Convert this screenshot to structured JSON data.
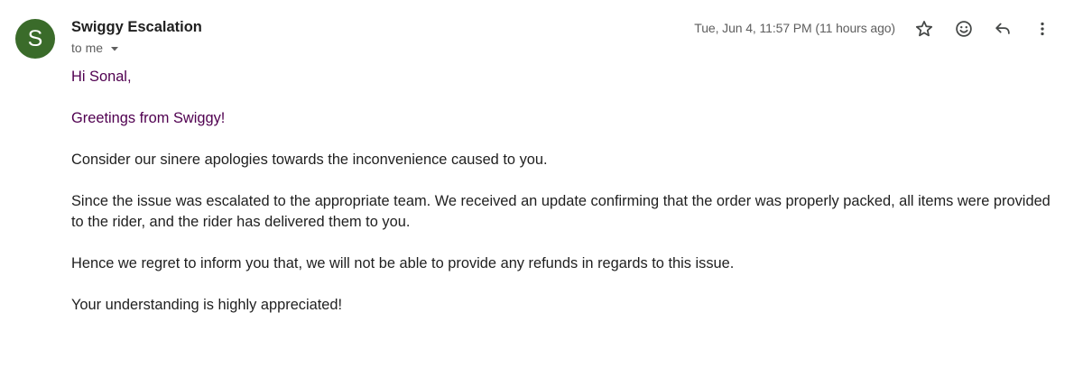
{
  "sender": {
    "initial": "S",
    "name": "Swiggy Escalation",
    "avatar_color": "#3a6b2a"
  },
  "recipient": {
    "text": "to me",
    "caret_icon": "chevron-down-icon"
  },
  "timestamp": "Tue, Jun 4, 11:57 PM (11 hours ago)",
  "actions": {
    "star_icon": "star-icon",
    "emoji_icon": "emoji-reaction-icon",
    "reply_icon": "reply-icon",
    "more_icon": "more-vertical-icon"
  },
  "message": {
    "greeting": "Hi Sonal,",
    "intro": "Greetings from Swiggy!",
    "apology": "Consider our sinere apologies towards the inconvenience caused to you.",
    "update": "Since the issue was escalated to the appropriate team. We received an update confirming that the order was properly packed, all items were provided to the rider, and the rider has delivered them to you.",
    "decision": "Hence we regret to inform you that, we will not be able to provide any refunds in regards to this issue.",
    "closing": "Your understanding is highly appreciated!"
  },
  "colors": {
    "quoted_text": "#500050",
    "secondary_text": "#5e5e5e",
    "icon": "#444746"
  }
}
